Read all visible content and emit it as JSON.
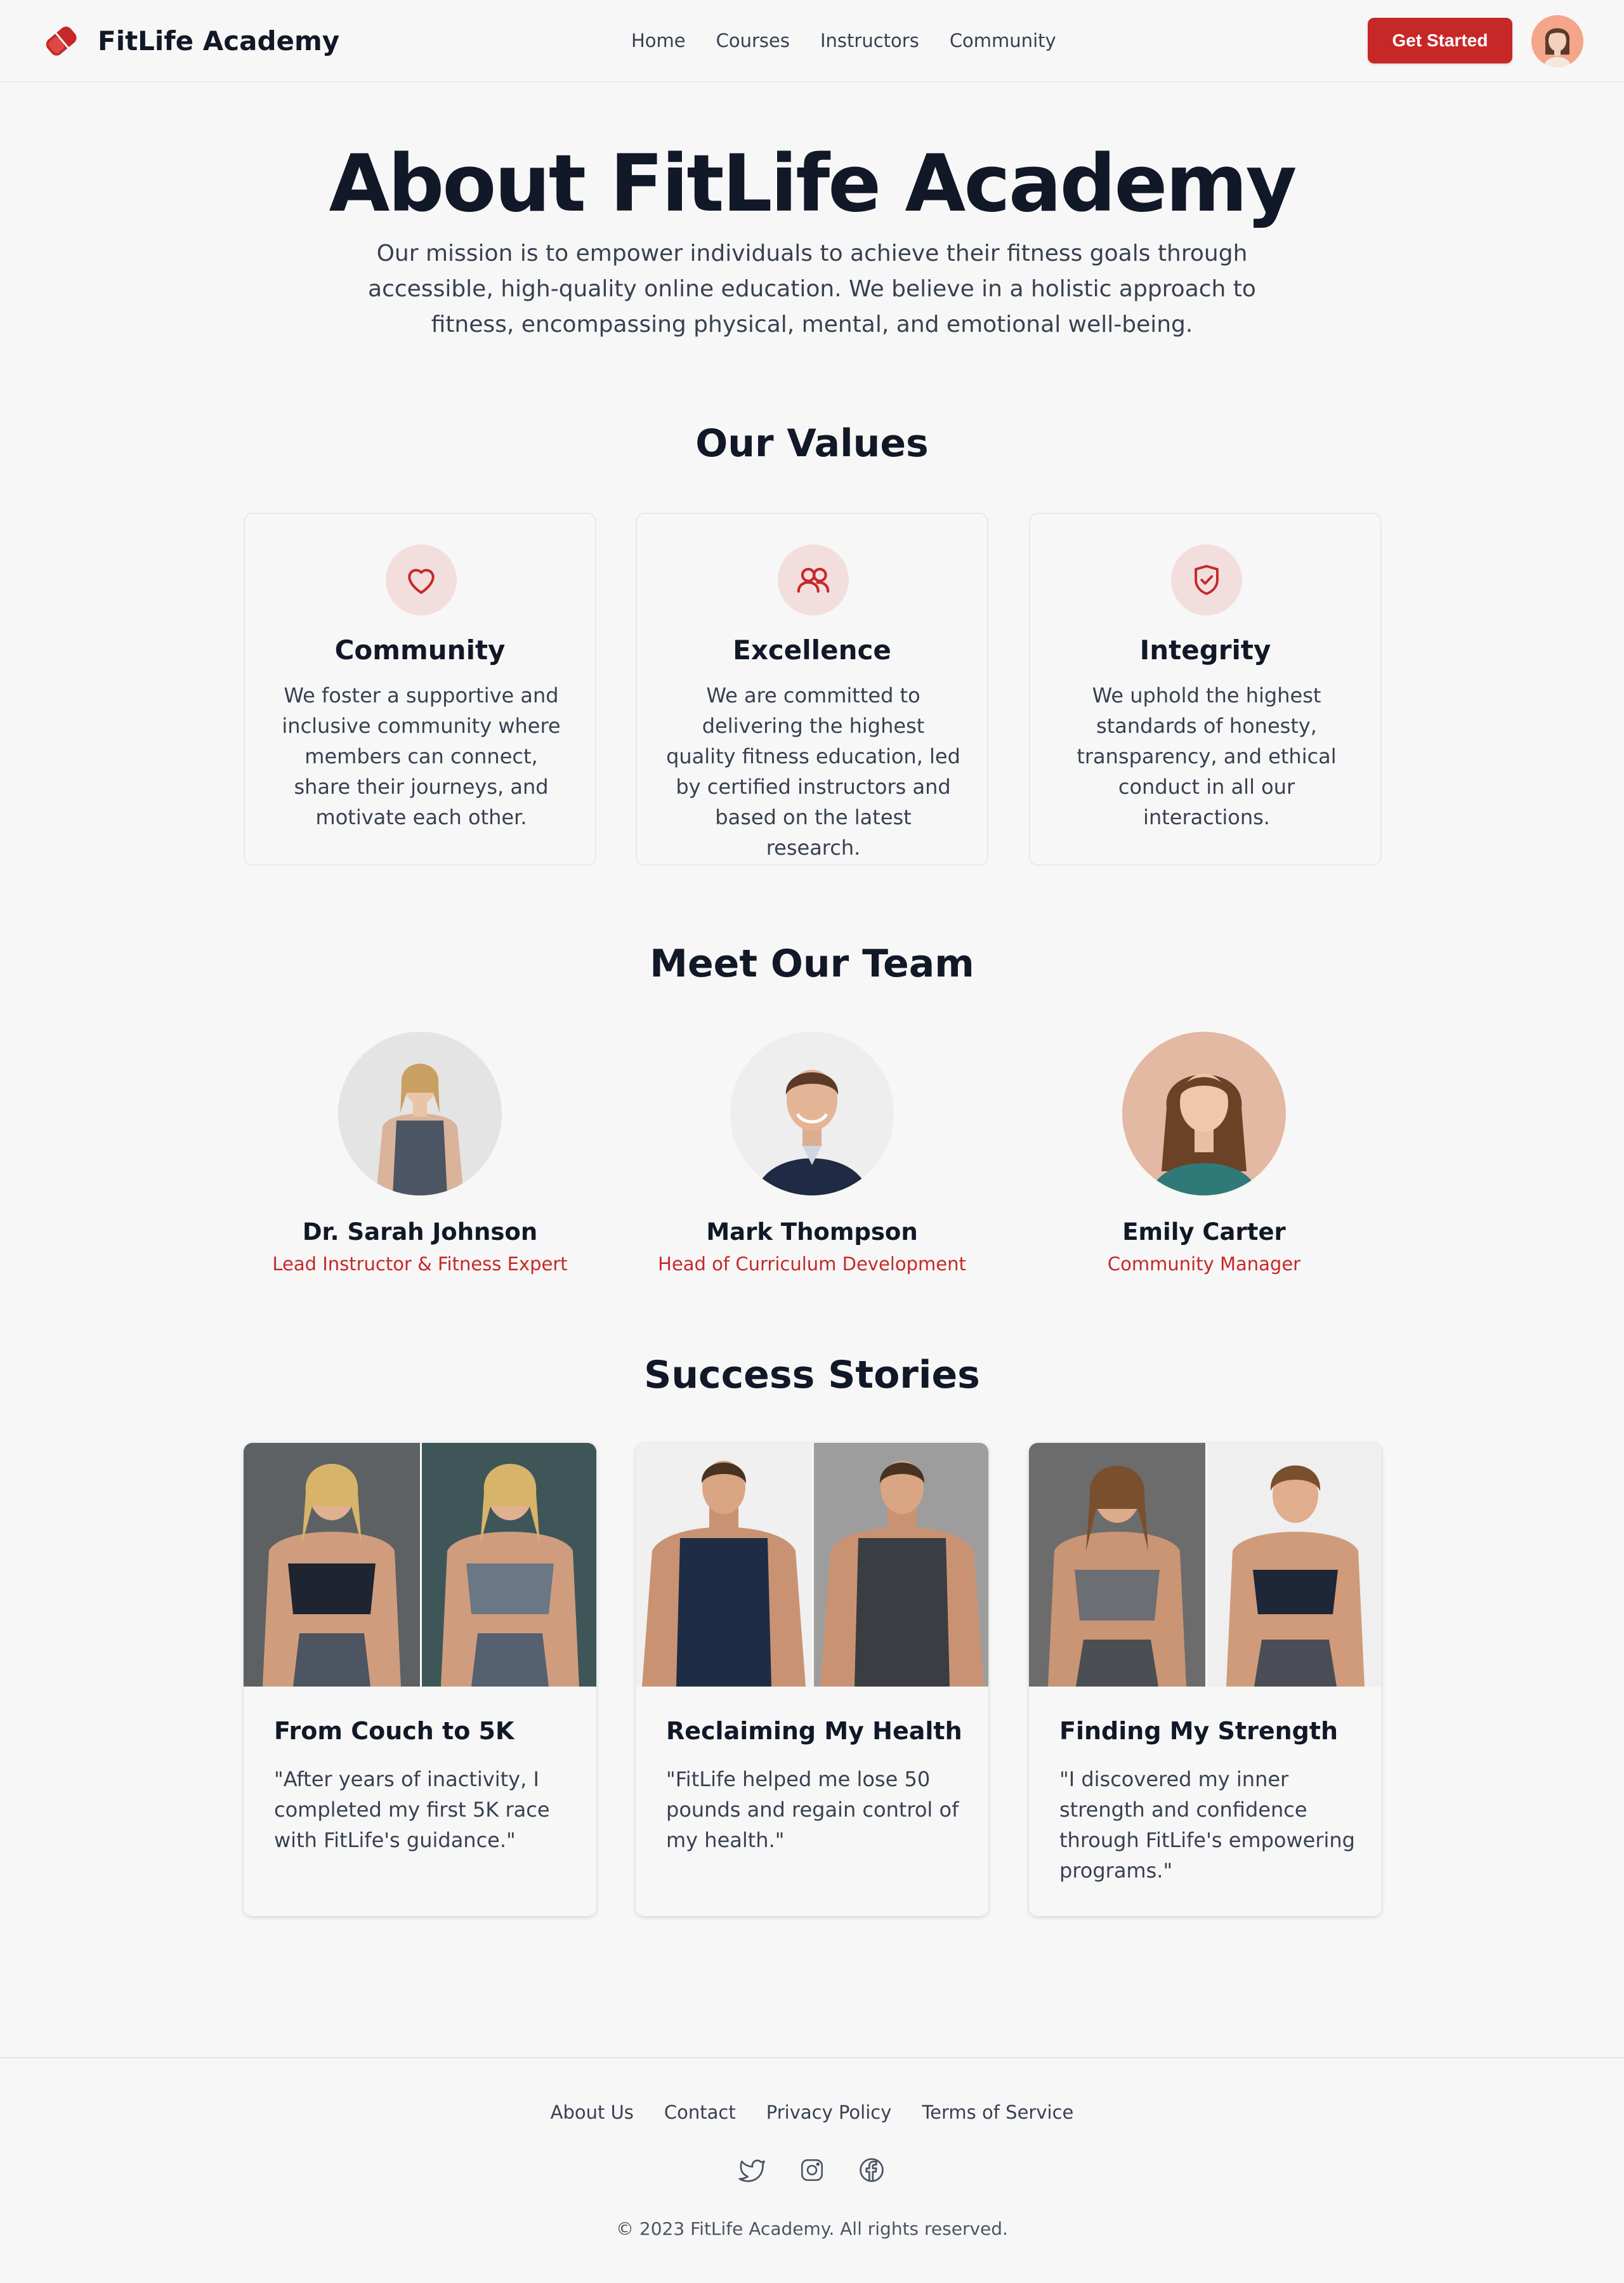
{
  "brand": {
    "name": "FitLife Academy",
    "accent": "#c62828"
  },
  "nav": {
    "items": [
      "Home",
      "Courses",
      "Instructors",
      "Community"
    ],
    "cta": "Get Started"
  },
  "hero": {
    "title": "About FitLife Academy",
    "text": "Our mission is to empower individuals to achieve their fitness goals through accessible, high-quality online education. We believe in a holistic approach to fitness, encompassing physical, mental, and emotional well-being."
  },
  "values": {
    "title": "Our Values",
    "items": [
      {
        "icon": "heart-icon",
        "title": "Community",
        "text": "We foster a supportive and inclusive community where members can connect, share their journeys, and motivate each other."
      },
      {
        "icon": "users-icon",
        "title": "Excellence",
        "text": "We are committed to delivering the highest quality fitness education, led by certified instructors and based on the latest research."
      },
      {
        "icon": "shield-check-icon",
        "title": "Integrity",
        "text": "We uphold the highest standards of honesty, transparency, and ethical conduct in all our interactions."
      }
    ]
  },
  "team": {
    "title": "Meet Our Team",
    "members": [
      {
        "name": "Dr. Sarah Johnson",
        "role": "Lead Instructor & Fitness Expert"
      },
      {
        "name": "Mark Thompson",
        "role": "Head of Curriculum Development"
      },
      {
        "name": "Emily Carter",
        "role": "Community Manager"
      }
    ]
  },
  "stories": {
    "title": "Success Stories",
    "items": [
      {
        "title": "From Couch to 5K",
        "quote": "\"After years of inactivity, I completed my first 5K race with FitLife's guidance.\""
      },
      {
        "title": "Reclaiming My Health",
        "quote": "\"FitLife helped me lose 50 pounds and regain control of my health.\""
      },
      {
        "title": "Finding My Strength",
        "quote": "\"I discovered my inner strength and confidence through FitLife's empowering programs.\""
      }
    ]
  },
  "footer": {
    "links": [
      "About Us",
      "Contact",
      "Privacy Policy",
      "Terms of Service"
    ],
    "socials": [
      "twitter-icon",
      "instagram-icon",
      "facebook-icon"
    ],
    "copyright": "© 2023 FitLife Academy. All rights reserved."
  }
}
